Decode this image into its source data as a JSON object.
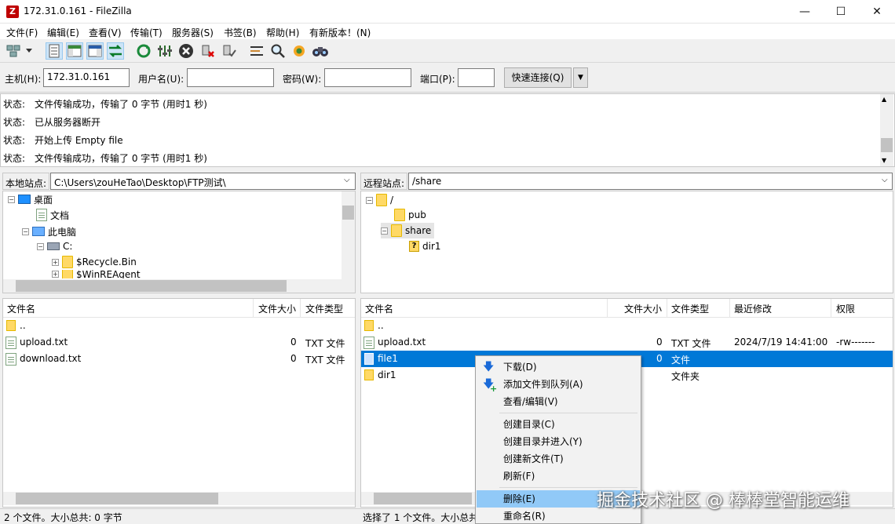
{
  "window": {
    "title": "172.31.0.161 - FileZilla",
    "app_icon": "Z",
    "minimize": "—",
    "maximize": "☐",
    "close": "✕"
  },
  "menu": [
    "文件(F)",
    "编辑(E)",
    "查看(V)",
    "传输(T)",
    "服务器(S)",
    "书签(B)",
    "帮助(H)",
    "有新版本！(N)"
  ],
  "toolbar": [
    "site-manager-icon",
    "dropdown-icon",
    "message-log-icon",
    "local-tree-icon",
    "remote-tree-icon",
    "transfer-queue-icon",
    "refresh-icon",
    "filter-icon",
    "cancel-icon",
    "disconnect-icon",
    "reconnect-icon",
    "directory-compare-icon",
    "search-icon",
    "sync-browse-icon",
    "find-icon"
  ],
  "quickconnect": {
    "host_label": "主机(H):",
    "host_value": "172.31.0.161",
    "user_label": "用户名(U):",
    "user_value": "",
    "pass_label": "密码(W):",
    "pass_value": "",
    "port_label": "端口(P):",
    "port_value": "",
    "connect_button": "快速连接(Q)",
    "dropdown": "▼"
  },
  "log": [
    {
      "label": "状态:",
      "text": "文件传输成功，传输了 0 字节 (用时1 秒)"
    },
    {
      "label": "状态:",
      "text": "已从服务器断开"
    },
    {
      "label": "状态:",
      "text": "开始上传 Empty file"
    },
    {
      "label": "状态:",
      "text": "文件传输成功，传输了 0 字节 (用时1 秒)"
    }
  ],
  "local": {
    "site_label": "本地站点:",
    "path": "C:\\Users\\zouHeTao\\Desktop\\FTP测试\\",
    "tree": [
      "桌面",
      "文档",
      "此电脑",
      "C:",
      "$Recycle.Bin",
      "$WinREAgent"
    ],
    "columns": [
      "文件名",
      "文件大小",
      "文件类型"
    ],
    "files": [
      {
        "name": "..",
        "size": "",
        "type": ""
      },
      {
        "name": "upload.txt",
        "size": "0",
        "type": "TXT 文件"
      },
      {
        "name": "download.txt",
        "size": "0",
        "type": "TXT 文件"
      }
    ],
    "status": "2 个文件。大小总共: 0 字节"
  },
  "remote": {
    "site_label": "远程站点:",
    "path": "/share",
    "tree": [
      "/",
      "pub",
      "share",
      "dir1"
    ],
    "columns": [
      "文件名",
      "文件大小",
      "文件类型",
      "最近修改",
      "权限"
    ],
    "files": [
      {
        "name": "..",
        "size": "",
        "type": "",
        "modified": "",
        "perm": ""
      },
      {
        "name": "upload.txt",
        "size": "0",
        "type": "TXT 文件",
        "modified": "2024/7/19 14:41:00",
        "perm": "-rw-------"
      },
      {
        "name": "file1",
        "size": "0",
        "type": "文件",
        "modified": "",
        "perm": ""
      },
      {
        "name": "dir1",
        "size": "",
        "type": "文件夹",
        "modified": "",
        "perm": ""
      }
    ],
    "status": "选择了 1 个文件。大小总共"
  },
  "context_menu": [
    "下载(D)",
    "添加文件到队列(A)",
    "查看/编辑(V)",
    "创建目录(C)",
    "创建目录并进入(Y)",
    "创建新文件(T)",
    "刷新(F)",
    "删除(E)",
    "重命名(R)"
  ],
  "watermark": "掘金技术社区 @ 棒棒堂智能运维",
  "colors": {
    "selection": "#0078d7",
    "menu_highlight": "#91c9f7",
    "folder": "#ffd966"
  }
}
